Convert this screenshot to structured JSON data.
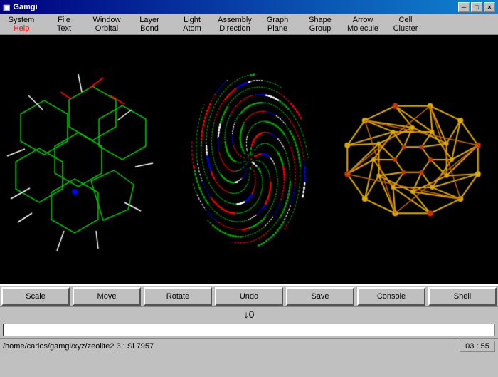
{
  "titlebar": {
    "title": "Gamgi",
    "icon": "■",
    "controls": [
      "─",
      "□",
      "×"
    ]
  },
  "menubar": {
    "columns": [
      {
        "top": "System",
        "bot": "Help",
        "bot_color": "red"
      },
      {
        "top": "File",
        "bot": "Text"
      },
      {
        "top": "Window",
        "bot": "Orbital"
      },
      {
        "top": "Layer",
        "bot": "Bond"
      },
      {
        "top": "Light",
        "bot": "Atom"
      },
      {
        "top": "Assembly",
        "bot": "Direction"
      },
      {
        "top": "Graph",
        "bot": "Plane"
      },
      {
        "top": "Shape",
        "bot": "Group"
      },
      {
        "top": "Arrow",
        "bot": "Molecule"
      },
      {
        "top": "Cell",
        "bot": "Cluster"
      }
    ]
  },
  "toolbar": {
    "buttons": [
      "Scale",
      "Move",
      "Rotate",
      "Undo",
      "Save",
      "Console",
      "Shell"
    ]
  },
  "arrow": "↓0",
  "input": {
    "value": "",
    "placeholder": ""
  },
  "statusbar": {
    "path": "/home/carlos/gamgi/xyz/zeolite2 3 : Si 7957",
    "time": "03 : 55"
  }
}
